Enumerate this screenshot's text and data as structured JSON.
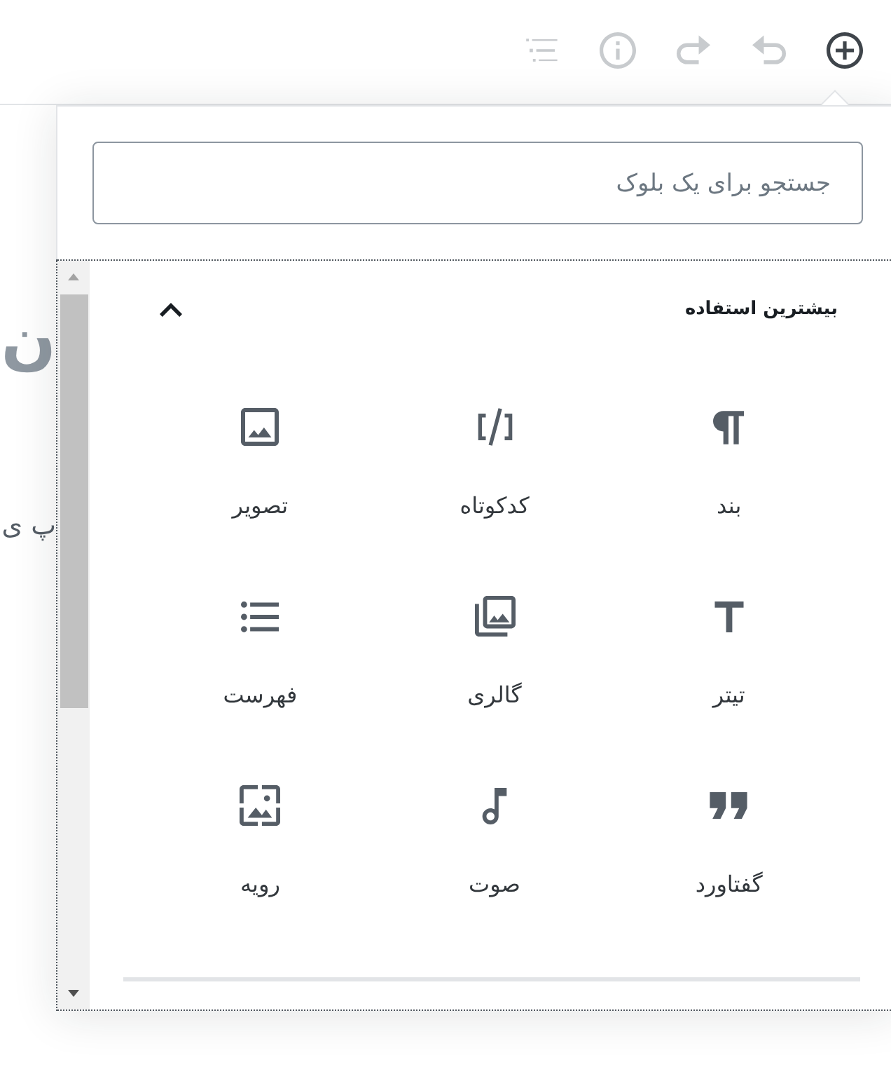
{
  "toolbar": {
    "buttons": [
      {
        "disabled": true
      },
      {
        "disabled": true
      },
      {
        "disabled": true
      },
      {
        "disabled": true
      },
      {
        "disabled": false
      }
    ]
  },
  "editor": {
    "title_fragment": "ن",
    "paragraph_fragment": "پ ی"
  },
  "inserter": {
    "search": {
      "placeholder": "جستجو برای یک بلوک"
    },
    "panel": {
      "title": "بیشترین استفاده",
      "expanded": true,
      "items": [
        {
          "label": "بند"
        },
        {
          "label": "کدکوتاه"
        },
        {
          "label": "تصویر"
        },
        {
          "label": "تیتر"
        },
        {
          "label": "گالری"
        },
        {
          "label": "فهرست"
        },
        {
          "label": "گفتاورد"
        },
        {
          "label": "صوت"
        },
        {
          "label": "رویه"
        }
      ]
    }
  }
}
